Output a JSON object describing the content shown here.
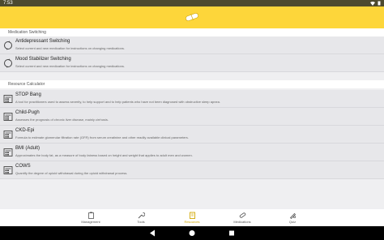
{
  "status": {
    "time": "7:53"
  },
  "sections": [
    {
      "header": "Medication Switching",
      "items": [
        {
          "title": "Antidepressant Switching",
          "desc": "Select current and new medication for instructions on changing medications.",
          "icon": "cycle-icon"
        },
        {
          "title": "Mood Stabilizer Switching",
          "desc": "Select current and new medication for instructions on changing medications.",
          "icon": "cycle-icon"
        }
      ]
    },
    {
      "header": "Resource Calculator",
      "items": [
        {
          "title": "STOP Bang",
          "desc": "A tool for practitioners used to assess severity, to help support and to help patients who have not been diagnosed with obstructive sleep apnea.",
          "icon": "calculator-icon"
        },
        {
          "title": "Child-Pugh",
          "desc": "Assesses the prognosis of chronic liver disease, mainly cirrhosis.",
          "icon": "calculator-icon"
        },
        {
          "title": "CKD-Epi",
          "desc": "Formula to estimate glomerular filtration rate (GFR) from serum creatinine and other readily available clinical parameters.",
          "icon": "calculator-icon"
        },
        {
          "title": "BMI (Adult)",
          "desc": "Approximates the body fat, as a measure of body fatness based on height and weight that applies to adult men and women.",
          "icon": "calculator-icon"
        },
        {
          "title": "COWS",
          "desc": "Quantify the degree of opioid withdrawal during the opioid withdrawal process.",
          "icon": "calculator-icon"
        }
      ]
    }
  ],
  "nav": {
    "items": [
      {
        "label": "Management",
        "icon": "clipboard-icon",
        "active": false
      },
      {
        "label": "Tools",
        "icon": "wrench-icon",
        "active": false
      },
      {
        "label": "Resources",
        "icon": "book-icon",
        "active": true
      },
      {
        "label": "Medications",
        "icon": "pill-icon",
        "active": false
      },
      {
        "label": "Quiz",
        "icon": "quiz-icon",
        "active": false
      }
    ]
  },
  "colors": {
    "accent": "#fdd63a",
    "active_nav": "#d1a700",
    "status_bar": "#4d4a2f"
  }
}
